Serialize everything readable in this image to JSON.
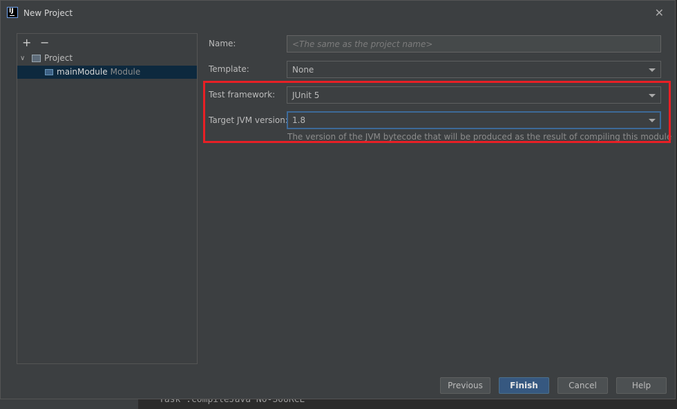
{
  "dialog": {
    "title": "New Project",
    "close_icon": "close-icon",
    "app_icon_text": "IJ"
  },
  "left_panel": {
    "add_label": "+",
    "remove_label": "−",
    "tree": {
      "project_label": "Project",
      "module_name": "mainModule",
      "module_type": "Module"
    }
  },
  "form": {
    "name_label": "Name:",
    "name_placeholder": "<The same as the project name>",
    "name_value": "",
    "template_label": "Template:",
    "template_value": "None",
    "test_framework_label": "Test framework:",
    "test_framework_value": "JUnit 5",
    "jvm_label": "Target JVM version:",
    "jvm_value": "1.8",
    "jvm_help": "The version of the JVM bytecode that will be produced as the result of compiling this module"
  },
  "buttons": {
    "previous": "Previous",
    "finish": "Finish",
    "cancel": "Cancel",
    "help": "Help"
  },
  "background": {
    "partial_text": "Task :compileJava NO-SOURCE"
  },
  "colors": {
    "highlight": "#e81f25",
    "accent": "#365880",
    "selection": "#0d293e"
  }
}
